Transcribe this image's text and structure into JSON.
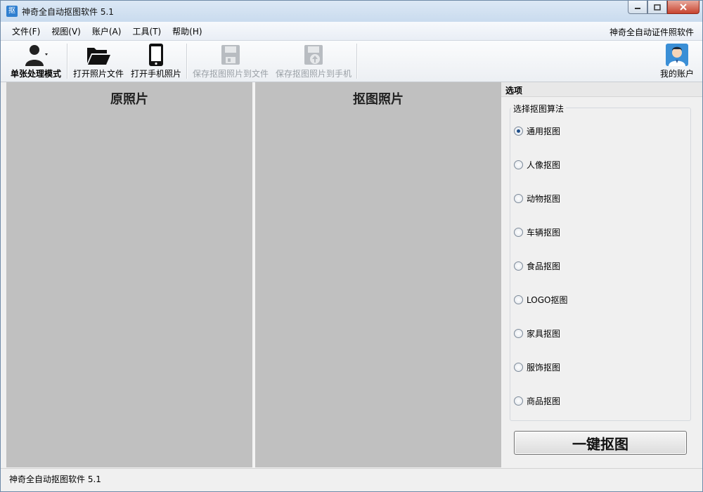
{
  "window": {
    "title": "神奇全自动抠图软件 5.1",
    "app_icon_glyph": "抠",
    "icon": "app-icon"
  },
  "menubar": {
    "items": [
      {
        "label": "文件(F)"
      },
      {
        "label": "视图(V)"
      },
      {
        "label": "账户(A)"
      },
      {
        "label": "工具(T)"
      },
      {
        "label": "帮助(H)"
      }
    ],
    "right_link": "神奇全自动证件照软件"
  },
  "toolbar": {
    "mode_label": "单张处理模式",
    "open_file_label": "打开照片文件",
    "open_phone_label": "打开手机照片",
    "save_file_label": "保存抠图照片到文件",
    "save_phone_label": "保存抠图照片到手机",
    "account_label": "我的账户",
    "icons": [
      "user-icon",
      "folder-open-icon",
      "phone-icon",
      "save-disk-icon",
      "save-upload-icon",
      "avatar-icon"
    ]
  },
  "panels": {
    "original_title": "原照片",
    "result_title": "抠图照片"
  },
  "options": {
    "header": "选项",
    "group_title": "选择抠图算法",
    "algorithms": [
      {
        "label": "通用抠图",
        "checked": true
      },
      {
        "label": "人像抠图",
        "checked": false
      },
      {
        "label": "动物抠图",
        "checked": false
      },
      {
        "label": "车辆抠图",
        "checked": false
      },
      {
        "label": "食品抠图",
        "checked": false
      },
      {
        "label": "LOGO抠图",
        "checked": false
      },
      {
        "label": "家具抠图",
        "checked": false
      },
      {
        "label": "服饰抠图",
        "checked": false
      },
      {
        "label": "商品抠图",
        "checked": false
      }
    ],
    "action_button": "一键抠图"
  },
  "statusbar": {
    "text": "神奇全自动抠图软件 5.1"
  },
  "colors": {
    "panel_bg": "#c0c0c0",
    "window_bg": "#f0f0f0",
    "radio_checked": "#1f4f8a"
  }
}
